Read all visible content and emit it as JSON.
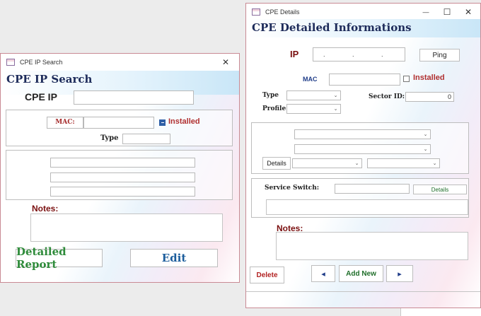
{
  "search_window": {
    "title": "CPE IP Search",
    "form_title": "CPE IP Search",
    "cpe_ip_label": "CPE IP",
    "cpe_ip_value": "",
    "mac_label": "MAC:",
    "mac_value": "",
    "installed_label": "Installed",
    "installed_checked": true,
    "type_label": "Type",
    "type_value": "",
    "notes_label": "Notes:",
    "notes_value": "",
    "detailed_report_label": "Detailed Report",
    "edit_label": "Edit",
    "close_symbol": "✕"
  },
  "details_window": {
    "title": "CPE Details",
    "form_title": "CPE Detailed Informations",
    "ip_label": "IP",
    "ip_value": ". . .",
    "ping_label": "Ping",
    "mac_label": "MAC",
    "mac_value": "",
    "installed_label": "Installed",
    "installed_checked": false,
    "type_label": "Type",
    "profile_label": "Profile",
    "sector_label": "Sector ID:",
    "sector_value": "0",
    "details_button_label": "Details",
    "service_switch_label": "Service Switch:",
    "service_details_label": "Details",
    "notes_label": "Notes:",
    "notes_value": "",
    "delete_label": "Delete",
    "add_new_label": "Add New",
    "prev_symbol": "◂",
    "next_symbol": "▸",
    "minimize_symbol": "—",
    "maximize_symbol": "☐",
    "close_symbol": "✕"
  },
  "colors": {
    "detailed_report": "#2e8b3a",
    "edit": "#1c5d9c",
    "mac_label": "#a52a2a",
    "nav_arrows": "#1f3c88",
    "delete": "#b22222",
    "add_new": "#1f6e2a",
    "notes_label": "#7a0f0f",
    "window_border": "#c98a94"
  },
  "icons": [
    "app-icon",
    "close-icon",
    "minimize-icon",
    "maximize-icon",
    "dropdown-arrow-icon",
    "prev-record-icon",
    "next-record-icon",
    "checkbox-icon"
  ]
}
